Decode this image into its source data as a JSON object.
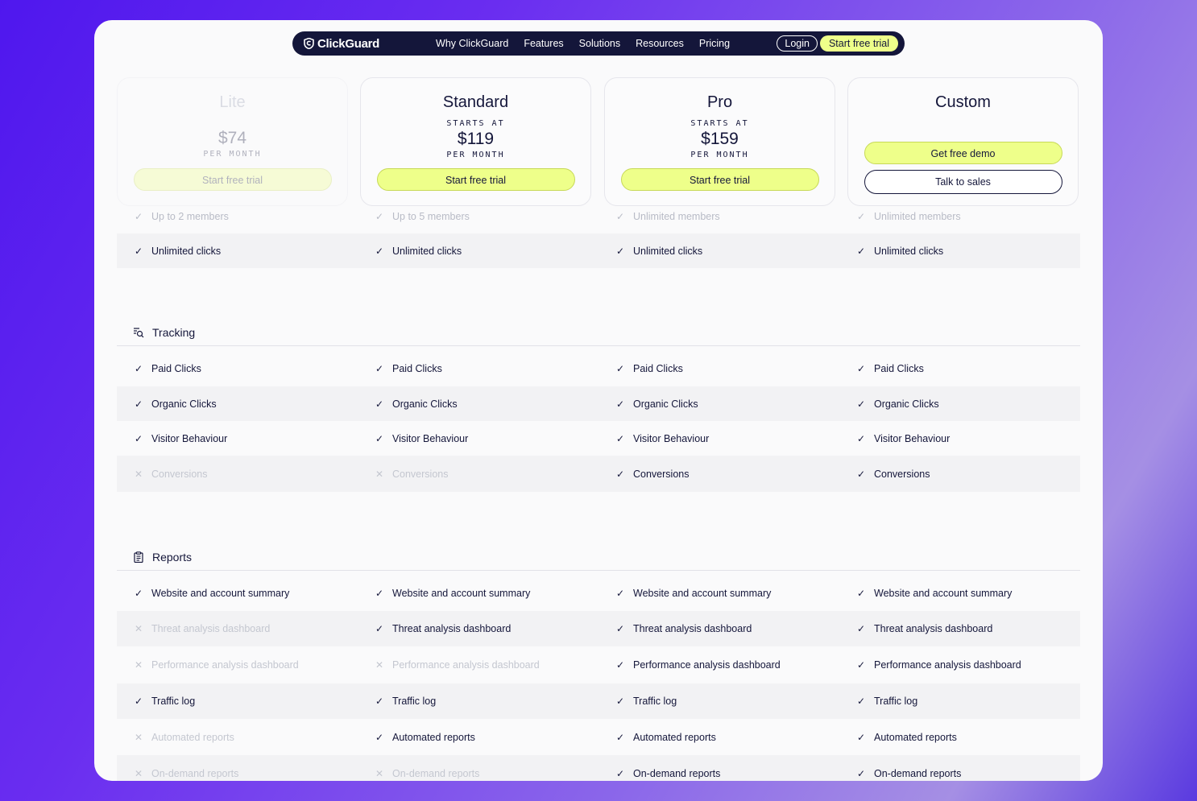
{
  "nav": {
    "brand": "ClickGuard",
    "menu": [
      "Why ClickGuard",
      "Features",
      "Solutions",
      "Resources",
      "Pricing"
    ],
    "login": "Login",
    "cta": "Start free trial"
  },
  "plans": [
    {
      "name": "Lite",
      "starts": "",
      "price": "$74",
      "per": "PER MONTH",
      "cta": "Start free trial",
      "cta2": ""
    },
    {
      "name": "Standard",
      "starts": "STARTS AT",
      "price": "$119",
      "per": "PER MONTH",
      "cta": "Start free trial",
      "cta2": ""
    },
    {
      "name": "Pro",
      "starts": "STARTS AT",
      "price": "$159",
      "per": "PER MONTH",
      "cta": "Start free trial",
      "cta2": ""
    },
    {
      "name": "Custom",
      "starts": "",
      "price": "",
      "per": "",
      "cta": "Get free demo",
      "cta2": "Talk to sales"
    }
  ],
  "members": [
    "Up to 2 members",
    "Up to 5 members",
    "Unlimited members",
    "Unlimited members"
  ],
  "clicks": [
    "Unlimited clicks",
    "Unlimited clicks",
    "Unlimited clicks",
    "Unlimited clicks"
  ],
  "tracking": {
    "title": "Tracking",
    "rows": [
      {
        "label": "Paid Clicks",
        "avail": [
          true,
          true,
          true,
          true
        ]
      },
      {
        "label": "Organic Clicks",
        "avail": [
          true,
          true,
          true,
          true
        ]
      },
      {
        "label": "Visitor Behaviour",
        "avail": [
          true,
          true,
          true,
          true
        ]
      },
      {
        "label": "Conversions",
        "avail": [
          false,
          false,
          true,
          true
        ]
      }
    ]
  },
  "reports": {
    "title": "Reports",
    "rows": [
      {
        "label": "Website and account summary",
        "avail": [
          true,
          true,
          true,
          true
        ]
      },
      {
        "label": "Threat analysis dashboard",
        "avail": [
          false,
          true,
          true,
          true
        ]
      },
      {
        "label": "Performance analysis dashboard",
        "avail": [
          false,
          false,
          true,
          true
        ]
      },
      {
        "label": "Traffic log",
        "avail": [
          true,
          true,
          true,
          true
        ]
      },
      {
        "label": "Automated reports",
        "avail": [
          false,
          true,
          true,
          true
        ]
      },
      {
        "label": "On-demand reports",
        "avail": [
          false,
          false,
          true,
          true
        ]
      }
    ]
  },
  "marks": {
    "yes": "✓",
    "no": "✕"
  }
}
